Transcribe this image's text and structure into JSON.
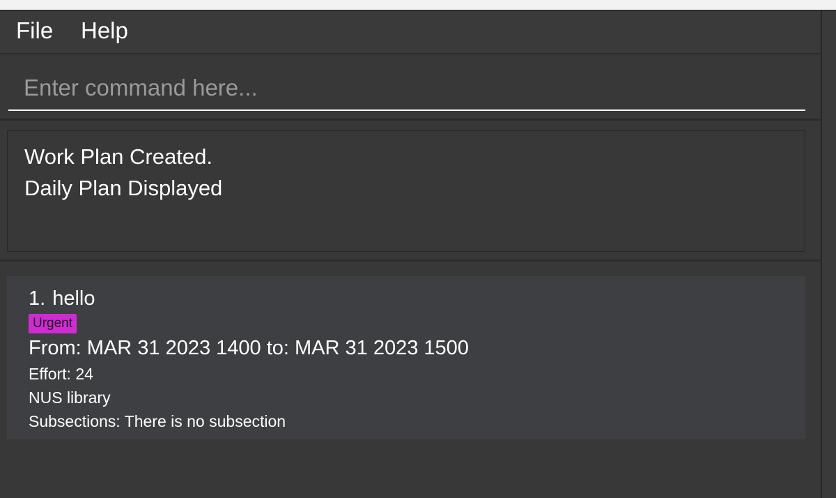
{
  "menu": {
    "file_label": "File",
    "help_label": "Help"
  },
  "command": {
    "placeholder": "Enter command here...",
    "value": ""
  },
  "result": {
    "lines": [
      "Work Plan Created.",
      "Daily Plan Displayed"
    ]
  },
  "tasks": [
    {
      "index": "1.",
      "title": "hello",
      "tag": "Urgent",
      "time": "From: MAR 31 2023 1400 to: MAR 31 2023 1500",
      "effort": "Effort: 24",
      "location": "NUS library",
      "subsections": "Subsections: There is no subsection"
    }
  ],
  "colors": {
    "background": "#383838",
    "card": "#3e3f42",
    "tag_urgent": "#d02bd2",
    "text": "#ffffff",
    "placeholder": "#9a9a9a"
  }
}
